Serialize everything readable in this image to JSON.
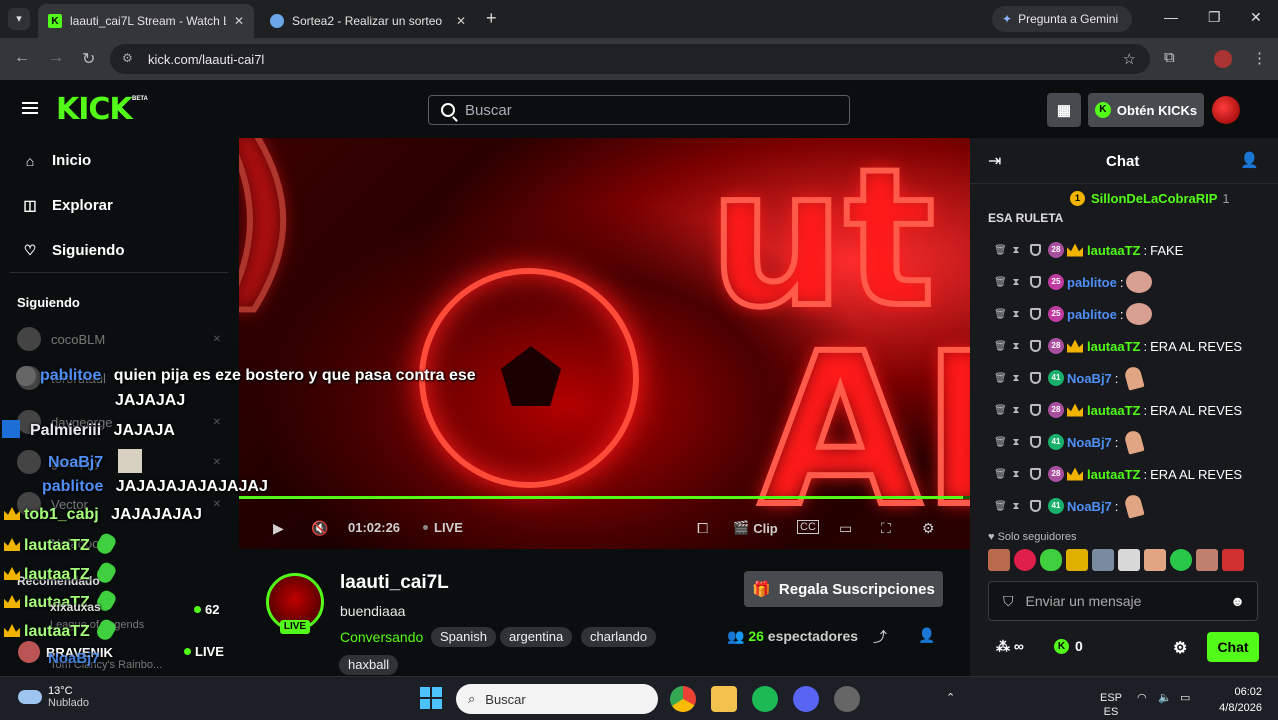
{
  "browser": {
    "tabs": [
      {
        "title": "laauti_cai7L Stream - Watch Live",
        "active": true
      },
      {
        "title": "Sortea2 - Realizar un sorteo",
        "active": false
      }
    ],
    "gemini_label": "Pregunta a Gemini",
    "url": "kick.com/laauti-cai7l"
  },
  "header": {
    "logo": "KICK",
    "beta": "BETA",
    "search_placeholder": "Buscar",
    "kicks_label": "Obtén KICKs"
  },
  "sidebar": {
    "nav": [
      {
        "label": "Inicio",
        "icon": "home-icon"
      },
      {
        "label": "Explorar",
        "icon": "compass-icon"
      },
      {
        "label": "Siguiendo",
        "icon": "heart-icon"
      }
    ],
    "following_title": "Siguiendo",
    "following": [
      "cocoBLM",
      "tororutaul",
      "daygeorge",
      "guooppy",
      "Vector",
      "Nolaooo"
    ],
    "recommended_title": "Recomendado",
    "recommended": [
      {
        "name": "xixauxas",
        "category": "League of Legends",
        "viewers": "62"
      },
      {
        "name": "BRAVENIK",
        "category": "Tom Clancy's Rainbo...",
        "viewers": "LIVE"
      }
    ]
  },
  "overlay_chat": [
    {
      "user": "pablitoe",
      "color": "blue",
      "text": "quien pija es eze bostero y que pasa contra ese"
    },
    {
      "user": "",
      "color": "white",
      "text": "JAJAJAJ"
    },
    {
      "user": "Palmieriii",
      "color": "white",
      "text": "JAJAJA"
    },
    {
      "user": "NoaBj7",
      "color": "blue",
      "text": ""
    },
    {
      "user": "pablitoe",
      "color": "blue",
      "text": "JAJAJAJAJAJAJAJ"
    },
    {
      "user": "tob1_cabj",
      "color": "green",
      "text": "JAJAJAJAJ"
    },
    {
      "user": "lautaaTZ",
      "color": "green",
      "text": ""
    },
    {
      "user": "lautaaTZ",
      "color": "green",
      "text": ""
    },
    {
      "user": "lautaaTZ",
      "color": "green",
      "text": ""
    },
    {
      "user": "lautaaTZ",
      "color": "green",
      "text": ""
    },
    {
      "user": "NoaBj7",
      "color": "blue",
      "text": ""
    }
  ],
  "player": {
    "time": "01:02:26",
    "live_label": "LIVE",
    "clip_label": "Clip",
    "progress": 0.99
  },
  "channel": {
    "name": "laauti_cai7L",
    "title": "buendiaaa",
    "category": "Conversando",
    "tags": [
      "Spanish",
      "argentina",
      "charlando",
      "haxball"
    ],
    "live_badge": "LIVE",
    "gift_label": "Regala Suscripciones",
    "viewers": "26",
    "viewers_label": "espectadores"
  },
  "chat": {
    "title": "Chat",
    "pinned_user": "SillonDeLaCobraRIP",
    "pinned_count": "1",
    "truncated_text": "ESA RULETA",
    "messages": [
      {
        "user": "lautaaTZ",
        "color": "#53fc18",
        "sub": "28",
        "crown": true,
        "text": "FAKE",
        "emote": ""
      },
      {
        "user": "pablitoe",
        "color": "#4f8ff7",
        "sub": "25",
        "crown": false,
        "text": "",
        "emote": "face"
      },
      {
        "user": "pablitoe",
        "color": "#4f8ff7",
        "sub": "25",
        "crown": false,
        "text": "",
        "emote": "face"
      },
      {
        "user": "lautaaTZ",
        "color": "#53fc18",
        "sub": "28",
        "crown": true,
        "text": "ERA AL REVES",
        "emote": ""
      },
      {
        "user": "NoaBj7",
        "color": "#4f8ff7",
        "sub": "41",
        "crown": false,
        "text": "",
        "emote": "finger"
      },
      {
        "user": "lautaaTZ",
        "color": "#53fc18",
        "sub": "28",
        "crown": true,
        "text": "ERA AL REVES",
        "emote": ""
      },
      {
        "user": "NoaBj7",
        "color": "#4f8ff7",
        "sub": "41",
        "crown": false,
        "text": "",
        "emote": "finger"
      },
      {
        "user": "lautaaTZ",
        "color": "#53fc18",
        "sub": "28",
        "crown": true,
        "text": "ERA AL REVES",
        "emote": ""
      },
      {
        "user": "NoaBj7",
        "color": "#4f8ff7",
        "sub": "41",
        "crown": false,
        "text": "",
        "emote": "finger"
      }
    ],
    "followers_only": "Solo seguidores",
    "input_placeholder": "Enviar un mensaje",
    "kicks_count": "0",
    "send_label": "Chat"
  },
  "taskbar": {
    "temp": "13°C",
    "weather": "Nublado",
    "search_placeholder": "Buscar",
    "lang1": "ESP",
    "lang2": "ES",
    "time": "06:02",
    "date": "4/8/2026"
  }
}
